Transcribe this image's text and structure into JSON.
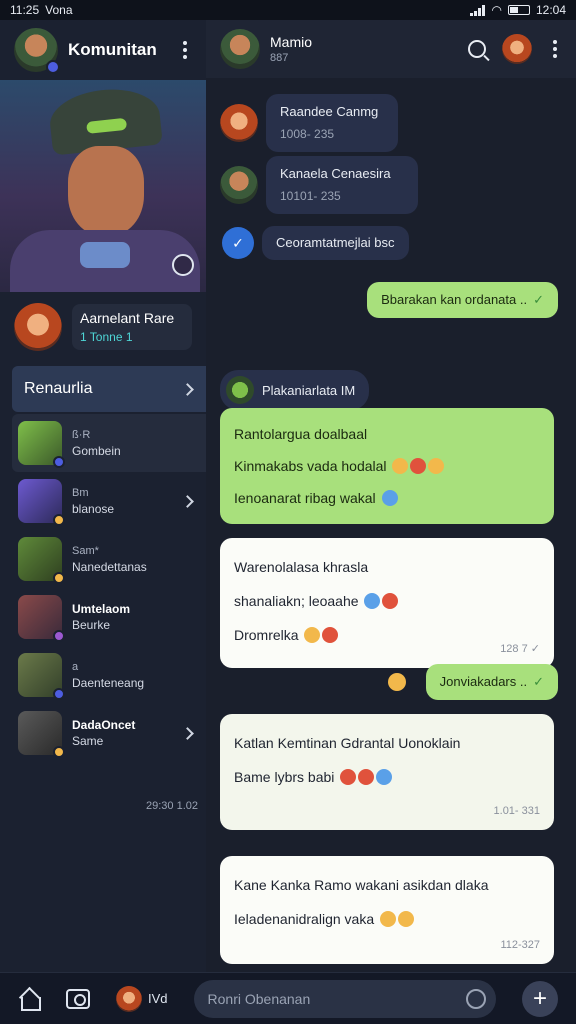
{
  "status_bar": {
    "time": "11:25",
    "carrier": "Vona",
    "right_time": "12:04"
  },
  "left_panel": {
    "title": "Komunitan",
    "profile": {
      "name": "Aarnelant Rare",
      "sub": "1 Tonne 1"
    },
    "section_label": "Renaurlia",
    "channels": [
      {
        "line1": "ß·R",
        "line2": "Gombein",
        "strong": false
      },
      {
        "line1": "Bm",
        "line2": "blanose",
        "strong": false
      },
      {
        "line1": "Sam*",
        "line2": "Nanedettanas",
        "strong": false
      },
      {
        "line1": "Umtelaom",
        "line2": "Beurke",
        "strong": true
      },
      {
        "line1": "a",
        "line2": "Daenteneang",
        "strong": false
      },
      {
        "line1": "DadaOncet",
        "line2": "Same",
        "strong": true
      }
    ],
    "timestamp": "29:30 1.02"
  },
  "chat": {
    "header": {
      "title": "Mamio",
      "sub": "887"
    },
    "messages": [
      {
        "name": "Raandee Canmg",
        "time": "1008- 235"
      },
      {
        "name": "Kanaela Cenaesira",
        "time": "10101- 235"
      },
      {
        "system": "Ceoramtatmejlai bsc"
      },
      {
        "outgoing": "Bbarakan kan ordanata .."
      },
      {
        "sender": "Plakaniarlata IM"
      },
      {
        "green_lines": [
          "Rantolargua doalbaal",
          "Kinmakabs vada hodalal",
          "Ienoanarat ribag wakal"
        ]
      },
      {
        "white_lines": [
          "Warenolalasa khrasla",
          "shanaliakn; leoaahe",
          "Dromrelka"
        ],
        "time": "128 7"
      },
      {
        "outgoing": "Jonviakadars .."
      },
      {
        "white_lines": [
          "Katlan Kemtinan Gdrantal Uonoklain",
          "Bame lybrs babi"
        ],
        "time": "1.01- 331"
      },
      {
        "white_lines": [
          "Kane Kanka Ramo wakani asikdan dlaka",
          "Ieladenanidralign vaka"
        ],
        "time": "112-327"
      }
    ]
  },
  "bottom_bar": {
    "mini_app_label": "IVd",
    "input_placeholder": "Ronri Obenanan"
  },
  "icons": [
    "home-icon",
    "camera-icon",
    "search-icon",
    "more-icon",
    "emoji-icon",
    "plus-icon",
    "chevron-right-icon",
    "camera-edit-icon"
  ],
  "colors": {
    "bg": "#1a1f2c",
    "panel": "#1b2130",
    "green_bubble": "#a8e07c",
    "accent_cyan": "#4ed6d6"
  }
}
